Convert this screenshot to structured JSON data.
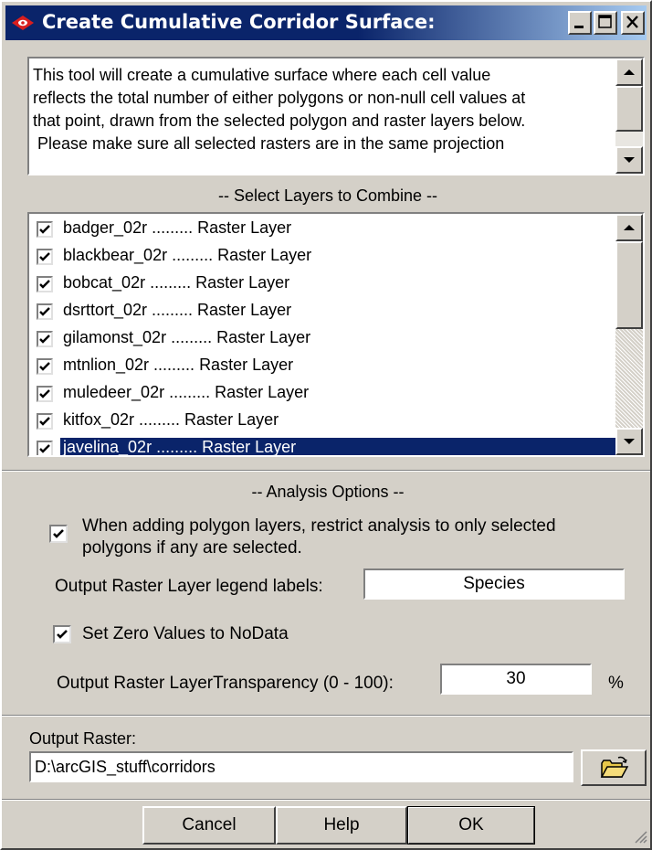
{
  "window": {
    "title": "Create Cumulative Corridor Surface:",
    "title_icon": "red-eye-icon",
    "controls": [
      "minimize-icon",
      "maximize-icon",
      "close-icon"
    ]
  },
  "description": {
    "lines": [
      "This tool will create a cumulative surface where each cell value",
      "reflects the total number of either polygons or non-null cell values at",
      "that point, drawn from the selected polygon and raster layers below.",
      " Please make sure all selected rasters are in the same projection"
    ]
  },
  "layers_section": {
    "title": "-- Select Layers to Combine --",
    "items": [
      {
        "label": "badger_02r ......... Raster Layer",
        "checked": true
      },
      {
        "label": "blackbear_02r ......... Raster Layer",
        "checked": true
      },
      {
        "label": "bobcat_02r ......... Raster Layer",
        "checked": true
      },
      {
        "label": "dsrttort_02r ......... Raster Layer",
        "checked": true
      },
      {
        "label": "gilamonst_02r ......... Raster Layer",
        "checked": true
      },
      {
        "label": "mtnlion_02r ......... Raster Layer",
        "checked": true
      },
      {
        "label": "muledeer_02r ......... Raster Layer",
        "checked": true
      },
      {
        "label": "kitfox_02r ......... Raster Layer",
        "checked": true
      },
      {
        "label": "javelina_02r ......... Raster Layer",
        "checked": true,
        "selected": true
      }
    ]
  },
  "analysis_options": {
    "title": "-- Analysis Options --",
    "restrict_polygons": {
      "line1": "When adding polygon layers, restrict analysis to only selected",
      "line2": "polygons if any are selected.",
      "checked": true
    },
    "legend_label": {
      "label": "Output Raster Layer legend labels:",
      "value": "Species"
    },
    "zero_nodata": {
      "label": "Set Zero Values to NoData",
      "checked": true
    },
    "transparency": {
      "label": "Output Raster LayerTransparency (0 - 100):",
      "value": "30",
      "unit": "%"
    }
  },
  "output": {
    "label": "Output Raster:",
    "value": "D:\\arcGIS_stuff\\corridors",
    "browse_icon": "open-folder-icon"
  },
  "buttons": {
    "cancel": "Cancel",
    "help": "Help",
    "ok": "OK"
  },
  "colors": {
    "face": "#d4d0c8",
    "title_bar": "#0a246a",
    "selection": "#0a246a"
  }
}
